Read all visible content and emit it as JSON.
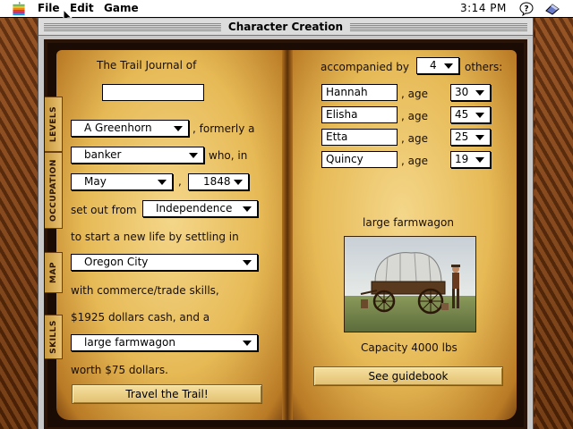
{
  "menubar": {
    "items": [
      "File",
      "Edit",
      "Game"
    ],
    "clock": "3:14 PM"
  },
  "window": {
    "title": "Character Creation"
  },
  "tabs": {
    "levels": "LEVELS",
    "occupation": "OCCUPATION",
    "map": "MAP",
    "skills": "SKILLS"
  },
  "left_page": {
    "journal_label": "The Trail Journal of",
    "name_value": "",
    "level_value": "A Greenhorn",
    "formerly_text": ", formerly a",
    "occupation_value": "banker",
    "who_in_text": "who, in",
    "month_value": "May",
    "comma": ",",
    "year_value": "1848",
    "set_out_text": "set out from",
    "origin_value": "Independence",
    "new_life_text": "to start a new life by settling in",
    "destination_value": "Oregon City",
    "skills_text": "with commerce/trade skills,",
    "cash_text": "$1925 dollars cash, and a",
    "wagon_value": "large farmwagon",
    "worth_text": "worth $75 dollars.",
    "travel_button": "Travel the Trail!"
  },
  "right_page": {
    "accompanied_text": "accompanied by",
    "companion_count": "4",
    "others_text": "others:",
    "age_label": ", age",
    "companions": [
      {
        "name": "Hannah",
        "age": "30"
      },
      {
        "name": "Elisha",
        "age": "45"
      },
      {
        "name": "Etta",
        "age": "25"
      },
      {
        "name": "Quincy",
        "age": "19"
      }
    ],
    "wagon_title": "large farmwagon",
    "capacity_text": "Capacity 4000 lbs",
    "guidebook_button": "See guidebook"
  }
}
